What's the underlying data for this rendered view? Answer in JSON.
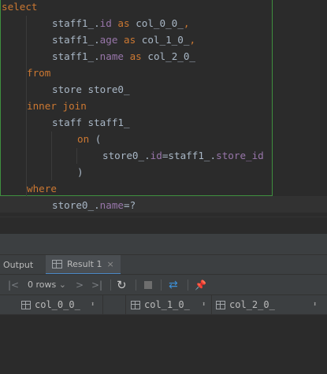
{
  "editor": {
    "lines": [
      {
        "tokens": [
          {
            "t": "select",
            "c": "kw"
          }
        ]
      },
      {
        "tokens": [
          {
            "t": "staff1_",
            "c": "plain"
          },
          {
            "t": ".",
            "c": "plain"
          },
          {
            "t": "id",
            "c": "ident"
          },
          {
            "t": " as ",
            "c": "kw"
          },
          {
            "t": "col_0_0_",
            "c": "plain"
          },
          {
            "t": ",",
            "c": "kw"
          }
        ]
      },
      {
        "tokens": [
          {
            "t": "staff1_",
            "c": "plain"
          },
          {
            "t": ".",
            "c": "plain"
          },
          {
            "t": "age",
            "c": "ident"
          },
          {
            "t": " as ",
            "c": "kw"
          },
          {
            "t": "col_1_0_",
            "c": "plain"
          },
          {
            "t": ",",
            "c": "kw"
          }
        ]
      },
      {
        "tokens": [
          {
            "t": "staff1_",
            "c": "plain"
          },
          {
            "t": ".",
            "c": "plain"
          },
          {
            "t": "name",
            "c": "ident"
          },
          {
            "t": " as ",
            "c": "kw"
          },
          {
            "t": "col_2_0_",
            "c": "plain"
          }
        ]
      },
      {
        "tokens": [
          {
            "t": "from",
            "c": "kw"
          }
        ]
      },
      {
        "tokens": [
          {
            "t": "store store0_",
            "c": "plain"
          }
        ]
      },
      {
        "tokens": [
          {
            "t": "inner join",
            "c": "kw"
          }
        ]
      },
      {
        "tokens": [
          {
            "t": "staff staff1_",
            "c": "plain"
          }
        ]
      },
      {
        "tokens": [
          {
            "t": "on",
            "c": "kw"
          },
          {
            "t": " (",
            "c": "plain"
          }
        ]
      },
      {
        "tokens": [
          {
            "t": "store0_",
            "c": "plain"
          },
          {
            "t": ".",
            "c": "plain"
          },
          {
            "t": "id",
            "c": "ident"
          },
          {
            "t": "=staff1_",
            "c": "plain"
          },
          {
            "t": ".",
            "c": "plain"
          },
          {
            "t": "store_id",
            "c": "ident"
          }
        ]
      },
      {
        "tokens": [
          {
            "t": ")",
            "c": "plain"
          }
        ]
      },
      {
        "tokens": [
          {
            "t": "where",
            "c": "kw"
          }
        ]
      },
      {
        "tokens": [
          {
            "t": "store0_",
            "c": "plain"
          },
          {
            "t": ".",
            "c": "plain"
          },
          {
            "t": "name",
            "c": "ident"
          },
          {
            "t": "=?",
            "c": "plain"
          }
        ]
      }
    ]
  },
  "tabs": {
    "output_label": "Output",
    "result_label": "Result 1",
    "close_glyph": "×"
  },
  "toolbar": {
    "rows_label": "0 rows",
    "dropdown_glyph": "⌄",
    "first_glyph": "|<",
    "prev_glyph": "<",
    "next_glyph": ">",
    "last_glyph": ">|",
    "refresh_glyph": "↻",
    "compare_glyph": "⇄",
    "pin_glyph": "📌"
  },
  "result": {
    "columns": [
      "col_0_0_",
      "col_1_0_",
      "col_2_0_"
    ],
    "sort_glyph": "⬍"
  },
  "colors": {
    "keyword": "#cc7832",
    "identifier": "#9876aa",
    "text": "#a9b7c6",
    "editor_bg": "#2b2b2b",
    "panel_bg": "#3c3f41",
    "accent_blue": "#4a88c7"
  }
}
